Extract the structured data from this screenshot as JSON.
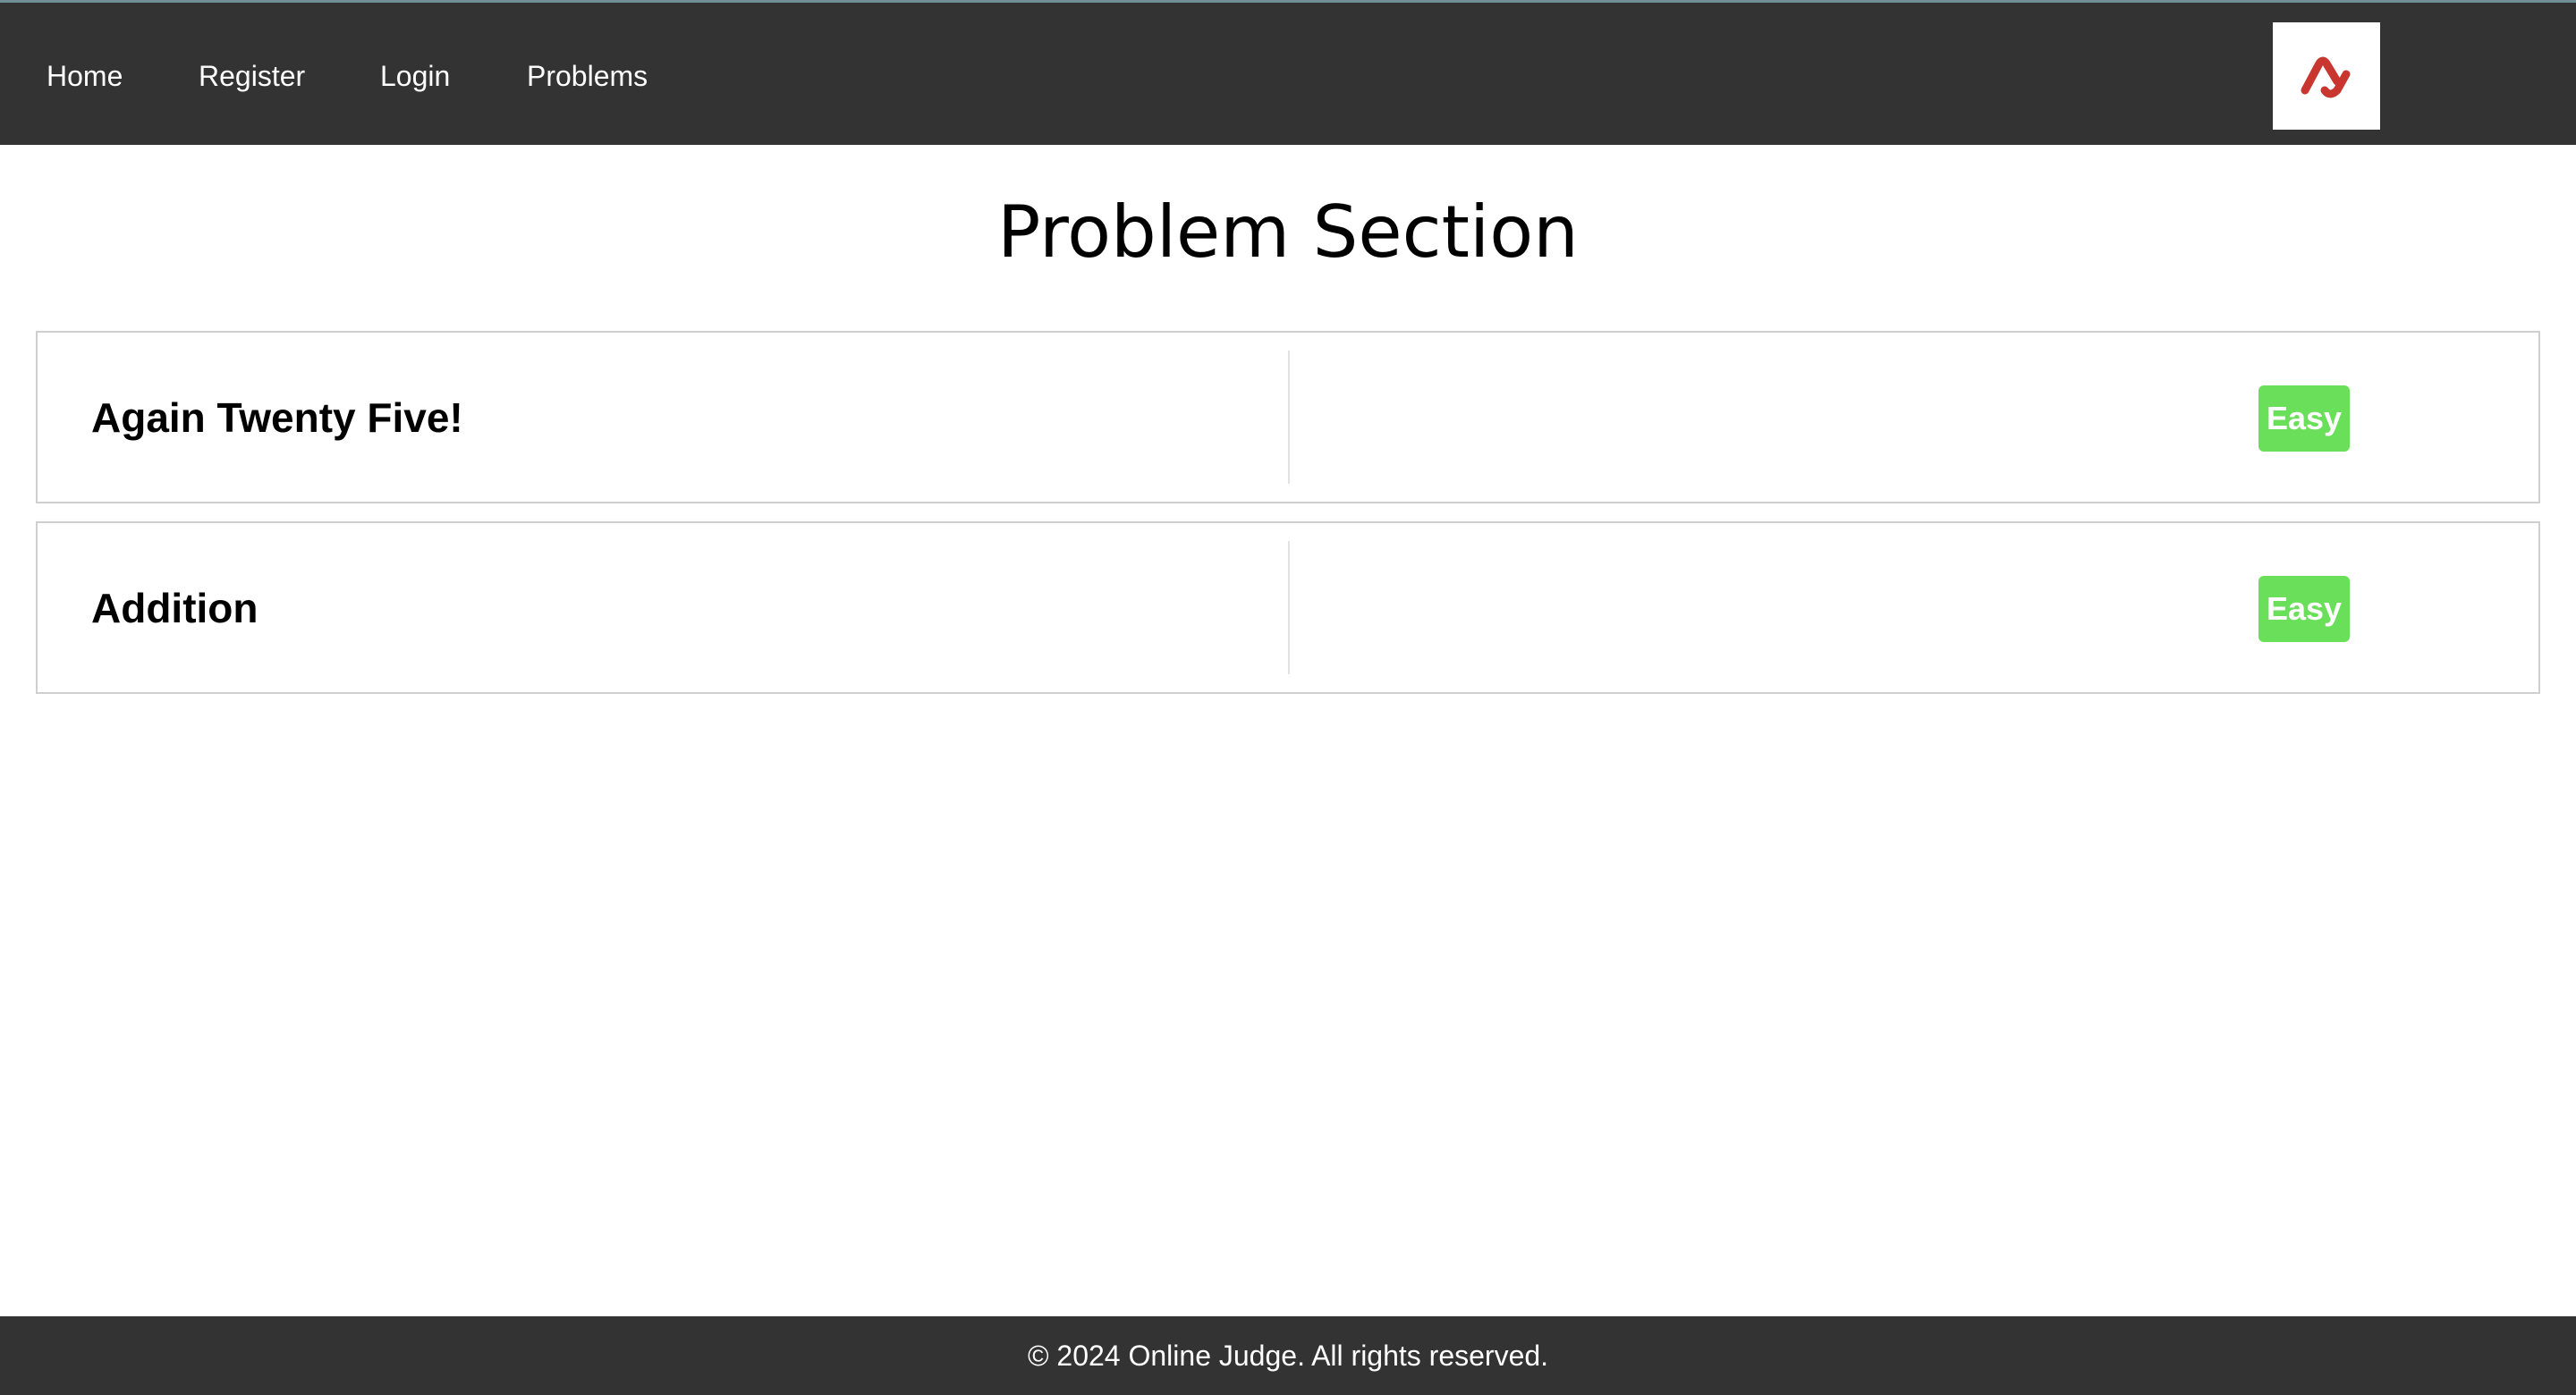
{
  "nav": {
    "items": [
      {
        "label": "Home"
      },
      {
        "label": "Register"
      },
      {
        "label": "Login"
      },
      {
        "label": "Problems"
      }
    ],
    "logo_icon": "logo-icon"
  },
  "main": {
    "title": "Problem Section",
    "problems": [
      {
        "title": "Again Twenty Five!",
        "difficulty": "Easy"
      },
      {
        "title": "Addition",
        "difficulty": "Easy"
      }
    ]
  },
  "footer": {
    "text": "© 2024 Online Judge. All rights reserved."
  },
  "colors": {
    "nav_background": "#333333",
    "footer_background": "#333333",
    "easy_badge": "#6ae05a",
    "logo_red": "#c8362f"
  }
}
